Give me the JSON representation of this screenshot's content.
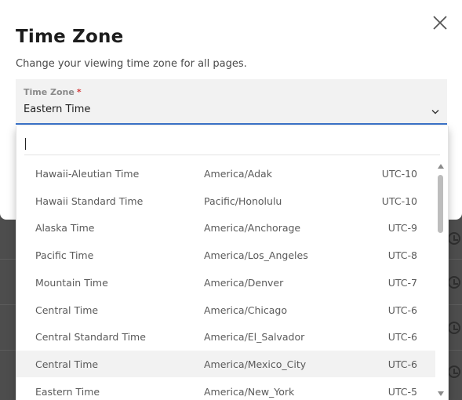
{
  "modal": {
    "title": "Time Zone",
    "subtitle": "Change your viewing time zone for all pages."
  },
  "field": {
    "label": "Time Zone",
    "required_mark": "*",
    "value": "Eastern Time"
  },
  "dropdown": {
    "search_value": "",
    "options": [
      {
        "name": "Hawaii-Aleutian Time",
        "id": "America/Adak",
        "offset": "UTC-10",
        "highlighted": false
      },
      {
        "name": "Hawaii Standard Time",
        "id": "Pacific/Honolulu",
        "offset": "UTC-10",
        "highlighted": false
      },
      {
        "name": "Alaska Time",
        "id": "America/Anchorage",
        "offset": "UTC-9",
        "highlighted": false
      },
      {
        "name": "Pacific Time",
        "id": "America/Los_Angeles",
        "offset": "UTC-8",
        "highlighted": false
      },
      {
        "name": "Mountain Time",
        "id": "America/Denver",
        "offset": "UTC-7",
        "highlighted": false
      },
      {
        "name": "Central Time",
        "id": "America/Chicago",
        "offset": "UTC-6",
        "highlighted": false
      },
      {
        "name": "Central Standard Time",
        "id": "America/El_Salvador",
        "offset": "UTC-6",
        "highlighted": false
      },
      {
        "name": "Central Time",
        "id": "America/Mexico_City",
        "offset": "UTC-6",
        "highlighted": true
      },
      {
        "name": "Eastern Time",
        "id": "America/New_York",
        "offset": "UTC-5",
        "highlighted": false
      }
    ]
  },
  "colors": {
    "accent": "#3b73c9",
    "required": "#d33a3a",
    "highlight_row": "#f2f2f2"
  },
  "icons": {
    "close": "close-icon",
    "chevron": "chevron-down-icon",
    "backdrop_row_icon": "clock-icon"
  }
}
